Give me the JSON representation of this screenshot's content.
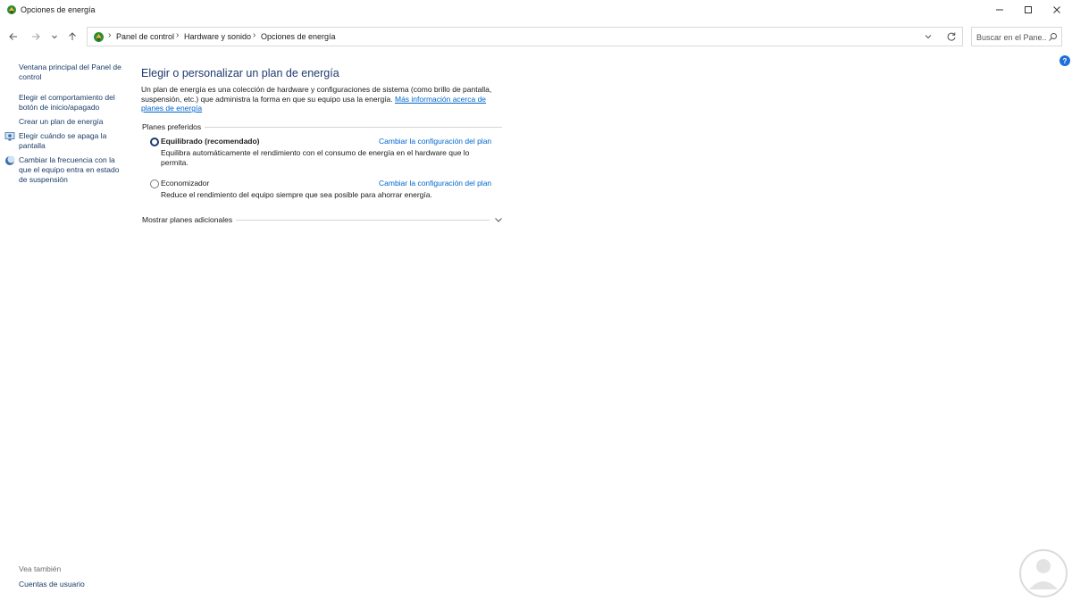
{
  "window": {
    "title": "Opciones de energía",
    "minimize_label": "–",
    "maximize_label": "□",
    "close_label": "✕"
  },
  "navigation": {
    "breadcrumb": [
      "Panel de control",
      "Hardware y sonido",
      "Opciones de energía"
    ],
    "search_placeholder": "Buscar en el Pane..."
  },
  "sidebar": {
    "items": [
      {
        "label": "Ventana principal del Panel de control"
      },
      {
        "label": "Elegir el comportamiento del botón de inicio/apagado"
      },
      {
        "label": "Crear un plan de energía"
      },
      {
        "label": "Elegir cuándo se apaga la pantalla",
        "icon": "monitor-icon"
      },
      {
        "label": "Cambiar la frecuencia con la que el equipo entra en estado de suspensión",
        "icon": "moon-icon"
      }
    ],
    "see_also": "Vea también",
    "see_also_items": [
      {
        "label": "Cuentas de usuario"
      }
    ]
  },
  "main": {
    "title": "Elegir o personalizar un plan de energía",
    "intro_text": "Un plan de energía es una colección de hardware y configuraciones de sistema (como brillo de pantalla, suspensión, etc.) que administra la forma en que su equipo usa la energía. ",
    "intro_link": "Más información acerca de planes de energía",
    "preferred_header": "Planes preferidos",
    "plans": [
      {
        "name": "Equilibrado (recomendado)",
        "selected": true,
        "change_link": "Cambiar la configuración del plan",
        "description": "Equilibra automáticamente el rendimiento con el consumo de energía en el hardware que lo permita."
      },
      {
        "name": "Economizador",
        "selected": false,
        "change_link": "Cambiar la configuración del plan",
        "description": "Reduce el rendimiento del equipo siempre que sea posible para ahorrar energía."
      }
    ],
    "more_plans": "Mostrar planes adicionales"
  },
  "colors": {
    "accent": "#1e3a6e",
    "link": "#0066cc",
    "sidebar_link": "#1a3c66"
  }
}
